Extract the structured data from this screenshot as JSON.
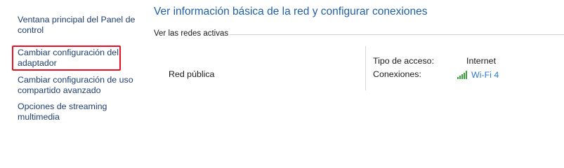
{
  "sidebar": {
    "items": [
      {
        "label": "Ventana principal del Panel de control"
      },
      {
        "label": "Cambiar configuración del adaptador"
      },
      {
        "label": "Cambiar configuración de uso compartido avanzado"
      },
      {
        "label": "Opciones de streaming multimedia"
      }
    ]
  },
  "main": {
    "title": "Ver información básica de la red y configurar conexiones",
    "section_label": "Ver las redes activas",
    "network": {
      "name": "Red pública",
      "access_type_label": "Tipo de acceso:",
      "access_type_value": "Internet",
      "connections_label": "Conexiones:",
      "connection_name": "Wi-Fi 4",
      "connection_icon": "wifi-signal-icon"
    }
  },
  "colors": {
    "link": "#1e3e73",
    "title": "#1f5fa8",
    "connection_link": "#2a7ad4",
    "highlight_border": "#e81123",
    "wifi_green": "#3aa13a"
  }
}
